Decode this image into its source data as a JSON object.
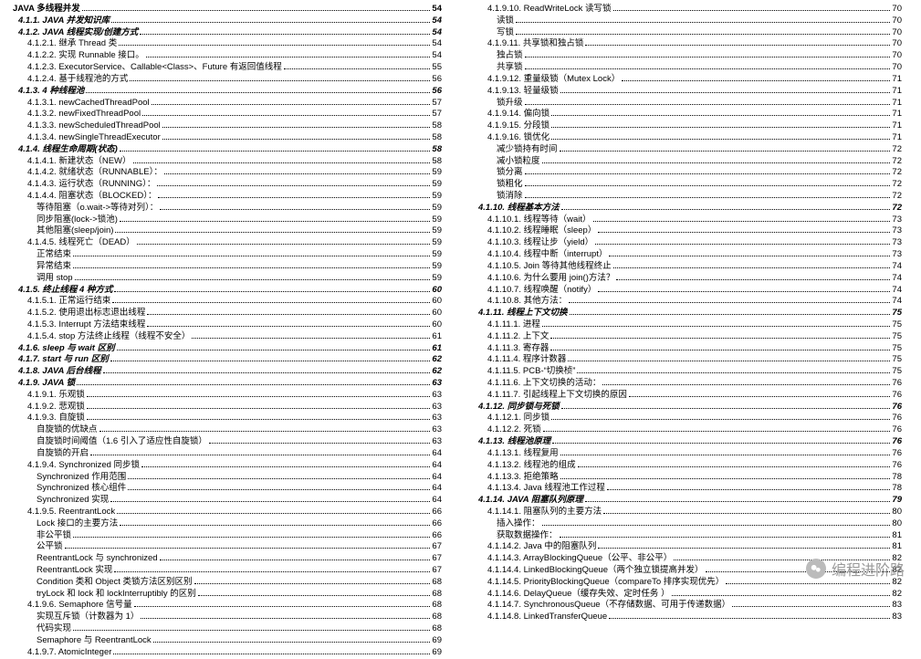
{
  "watermark": {
    "text": "编程进阶路"
  },
  "columns": [
    [
      {
        "lvl": 0,
        "t": "JAVA 多线程并发",
        "p": "54"
      },
      {
        "lvl": 1,
        "t": "4.1.1.  JAVA 并发知识库",
        "p": "54"
      },
      {
        "lvl": 1,
        "t": "4.1.2.  JAVA 线程实现/创建方式",
        "p": "54"
      },
      {
        "lvl": 2,
        "t": "4.1.2.1.  继承 Thread 类",
        "p": "54"
      },
      {
        "lvl": 2,
        "t": "4.1.2.2.  实现 Runnable 接口。",
        "p": "54"
      },
      {
        "lvl": 2,
        "t": "4.1.2.3.  ExecutorService、Callable<Class>、Future 有返回值线程",
        "p": "55"
      },
      {
        "lvl": 2,
        "t": "4.1.2.4.  基于线程池的方式",
        "p": "56"
      },
      {
        "lvl": 1,
        "t": "4.1.3.  4 种线程池",
        "p": "56"
      },
      {
        "lvl": 2,
        "t": "4.1.3.1.  newCachedThreadPool",
        "p": "57"
      },
      {
        "lvl": 2,
        "t": "4.1.3.2.  newFixedThreadPool",
        "p": "57"
      },
      {
        "lvl": 2,
        "t": "4.1.3.3.  newScheduledThreadPool",
        "p": "58"
      },
      {
        "lvl": 2,
        "t": "4.1.3.4.  newSingleThreadExecutor",
        "p": "58"
      },
      {
        "lvl": 1,
        "t": "4.1.4.  线程生命周期(状态)",
        "p": "58"
      },
      {
        "lvl": 2,
        "t": "4.1.4.1.  新建状态（NEW）",
        "p": "58"
      },
      {
        "lvl": 2,
        "t": "4.1.4.2.  就绪状态（RUNNABLE）：",
        "p": "59"
      },
      {
        "lvl": 2,
        "t": "4.1.4.3.  运行状态（RUNNING）：",
        "p": "59"
      },
      {
        "lvl": 2,
        "t": "4.1.4.4.  阻塞状态（BLOCKED）：",
        "p": "59"
      },
      {
        "lvl": 3,
        "t": "等待阻塞（o.wait->等待对列）：",
        "p": "59"
      },
      {
        "lvl": 3,
        "t": "同步阻塞(lock->锁池)",
        "p": "59"
      },
      {
        "lvl": 3,
        "t": "其他阻塞(sleep/join)",
        "p": "59"
      },
      {
        "lvl": 2,
        "t": "4.1.4.5.  线程死亡（DEAD）",
        "p": "59"
      },
      {
        "lvl": 3,
        "t": "正常结束",
        "p": "59"
      },
      {
        "lvl": 3,
        "t": "异常结束",
        "p": "59"
      },
      {
        "lvl": 3,
        "t": "调用 stop",
        "p": "59"
      },
      {
        "lvl": 1,
        "t": "4.1.5.  终止线程 4 种方式",
        "p": "60"
      },
      {
        "lvl": 2,
        "t": "4.1.5.1.  正常运行结束",
        "p": "60"
      },
      {
        "lvl": 2,
        "t": "4.1.5.2.  使用退出标志退出线程",
        "p": "60"
      },
      {
        "lvl": 2,
        "t": "4.1.5.3.  Interrupt 方法结束线程",
        "p": "60"
      },
      {
        "lvl": 2,
        "t": "4.1.5.4.  stop 方法终止线程（线程不安全）",
        "p": "61"
      },
      {
        "lvl": 1,
        "t": "4.1.6.  sleep 与 wait 区别",
        "p": "61"
      },
      {
        "lvl": 1,
        "t": "4.1.7.  start 与 run 区别",
        "p": "62"
      },
      {
        "lvl": 1,
        "t": "4.1.8.  JAVA 后台线程",
        "p": "62"
      },
      {
        "lvl": 1,
        "t": "4.1.9.  JAVA 锁",
        "p": "63"
      },
      {
        "lvl": 2,
        "t": "4.1.9.1.  乐观锁",
        "p": "63"
      },
      {
        "lvl": 2,
        "t": "4.1.9.2.  悲观锁",
        "p": "63"
      },
      {
        "lvl": 2,
        "t": "4.1.9.3.  自旋锁",
        "p": "63"
      },
      {
        "lvl": 3,
        "t": "自旋锁的优缺点",
        "p": "63"
      },
      {
        "lvl": 3,
        "t": "自旋锁时间阈值（1.6 引入了适应性自旋锁）",
        "p": "63"
      },
      {
        "lvl": 3,
        "t": "自旋锁的开启",
        "p": "64"
      },
      {
        "lvl": 2,
        "t": "4.1.9.4.  Synchronized 同步锁",
        "p": "64"
      },
      {
        "lvl": 3,
        "t": "Synchronized 作用范围",
        "p": "64"
      },
      {
        "lvl": 3,
        "t": "Synchronized 核心组件",
        "p": "64"
      },
      {
        "lvl": 3,
        "t": "Synchronized 实现",
        "p": "64"
      },
      {
        "lvl": 2,
        "t": "4.1.9.5.  ReentrantLock",
        "p": "66"
      },
      {
        "lvl": 3,
        "t": "Lock 接口的主要方法",
        "p": "66"
      },
      {
        "lvl": 3,
        "t": "非公平锁",
        "p": "66"
      },
      {
        "lvl": 3,
        "t": "公平锁",
        "p": "67"
      },
      {
        "lvl": 3,
        "t": "ReentrantLock 与 synchronized",
        "p": "67"
      },
      {
        "lvl": 3,
        "t": "ReentrantLock 实现",
        "p": "67"
      },
      {
        "lvl": 3,
        "t": "Condition 类和 Object 类锁方法区别区别",
        "p": "68"
      },
      {
        "lvl": 3,
        "t": "tryLock 和 lock 和 lockInterruptibly 的区别",
        "p": "68"
      },
      {
        "lvl": 2,
        "t": "4.1.9.6.  Semaphore 信号量",
        "p": "68"
      },
      {
        "lvl": 3,
        "t": "实现互斥锁（计数器为 1）",
        "p": "68"
      },
      {
        "lvl": 3,
        "t": "代码实现",
        "p": "68"
      },
      {
        "lvl": 3,
        "t": "Semaphore 与 ReentrantLock",
        "p": "69"
      },
      {
        "lvl": 2,
        "t": "4.1.9.7.  AtomicInteger",
        "p": "69"
      }
    ],
    [
      {
        "lvl": 2,
        "t": "4.1.9.10.  ReadWriteLock 读写锁",
        "p": "70"
      },
      {
        "lvl": 3,
        "t": "读锁",
        "p": "70"
      },
      {
        "lvl": 3,
        "t": "写锁",
        "p": "70"
      },
      {
        "lvl": 2,
        "t": "4.1.9.11.  共享锁和独占锁",
        "p": "70"
      },
      {
        "lvl": 3,
        "t": "独占锁",
        "p": "70"
      },
      {
        "lvl": 3,
        "t": "共享锁",
        "p": "70"
      },
      {
        "lvl": 2,
        "t": "4.1.9.12.  重量级锁（Mutex Lock）",
        "p": "71"
      },
      {
        "lvl": 2,
        "t": "4.1.9.13.  轻量级锁",
        "p": "71"
      },
      {
        "lvl": 3,
        "t": "锁升级",
        "p": "71"
      },
      {
        "lvl": 2,
        "t": "4.1.9.14.  偏向锁",
        "p": "71"
      },
      {
        "lvl": 2,
        "t": "4.1.9.15.  分段锁",
        "p": "71"
      },
      {
        "lvl": 2,
        "t": "4.1.9.16.  锁优化",
        "p": "71"
      },
      {
        "lvl": 3,
        "t": "减少锁持有时间",
        "p": "72"
      },
      {
        "lvl": 3,
        "t": "减小锁粒度",
        "p": "72"
      },
      {
        "lvl": 3,
        "t": "锁分离",
        "p": "72"
      },
      {
        "lvl": 3,
        "t": "锁粗化",
        "p": "72"
      },
      {
        "lvl": 3,
        "t": "锁消除",
        "p": "72"
      },
      {
        "lvl": 1,
        "t": "4.1.10.  线程基本方法",
        "p": "72"
      },
      {
        "lvl": 2,
        "t": "4.1.10.1.  线程等待（wait）",
        "p": "73"
      },
      {
        "lvl": 2,
        "t": "4.1.10.2.  线程睡眠（sleep）",
        "p": "73"
      },
      {
        "lvl": 2,
        "t": "4.1.10.3.  线程让步（yield）",
        "p": "73"
      },
      {
        "lvl": 2,
        "t": "4.1.10.4.  线程中断（interrupt）",
        "p": "73"
      },
      {
        "lvl": 2,
        "t": "4.1.10.5.  Join 等待其他线程终止",
        "p": "74"
      },
      {
        "lvl": 2,
        "t": "4.1.10.6.  为什么要用 join()方法？",
        "p": "74"
      },
      {
        "lvl": 2,
        "t": "4.1.10.7.  线程唤醒（notify）",
        "p": "74"
      },
      {
        "lvl": 2,
        "t": "4.1.10.8.  其他方法：",
        "p": "74"
      },
      {
        "lvl": 1,
        "t": "4.1.11.  线程上下文切换",
        "p": "75"
      },
      {
        "lvl": 2,
        "t": "4.1.11.1.  进程",
        "p": "75"
      },
      {
        "lvl": 2,
        "t": "4.1.11.2.  上下文",
        "p": "75"
      },
      {
        "lvl": 2,
        "t": "4.1.11.3.  寄存器",
        "p": "75"
      },
      {
        "lvl": 2,
        "t": "4.1.11.4.  程序计数器",
        "p": "75"
      },
      {
        "lvl": 2,
        "t": "4.1.11.5.  PCB-“切换桢”",
        "p": "75"
      },
      {
        "lvl": 2,
        "t": "4.1.11.6.  上下文切换的活动：",
        "p": "76"
      },
      {
        "lvl": 2,
        "t": "4.1.11.7.  引起线程上下文切换的原因",
        "p": "76"
      },
      {
        "lvl": 1,
        "t": "4.1.12.  同步锁与死锁",
        "p": "76"
      },
      {
        "lvl": 2,
        "t": "4.1.12.1.  同步锁",
        "p": "76"
      },
      {
        "lvl": 2,
        "t": "4.1.12.2.  死锁",
        "p": "76"
      },
      {
        "lvl": 1,
        "t": "4.1.13.  线程池原理",
        "p": "76"
      },
      {
        "lvl": 2,
        "t": "4.1.13.1.  线程复用",
        "p": "76"
      },
      {
        "lvl": 2,
        "t": "4.1.13.2.  线程池的组成",
        "p": "76"
      },
      {
        "lvl": 2,
        "t": "4.1.13.3.  拒绝策略",
        "p": "78"
      },
      {
        "lvl": 2,
        "t": "4.1.13.4.  Java 线程池工作过程",
        "p": "78"
      },
      {
        "lvl": 1,
        "t": "4.1.14.  JAVA 阻塞队列原理",
        "p": "79"
      },
      {
        "lvl": 2,
        "t": "4.1.14.1.  阻塞队列的主要方法",
        "p": "80"
      },
      {
        "lvl": 3,
        "t": "插入操作：",
        "p": "80"
      },
      {
        "lvl": 3,
        "t": "获取数据操作：",
        "p": "81"
      },
      {
        "lvl": 2,
        "t": "4.1.14.2.  Java 中的阻塞队列",
        "p": "81"
      },
      {
        "lvl": 2,
        "t": "4.1.14.3.  ArrayBlockingQueue（公平、非公平）",
        "p": "82"
      },
      {
        "lvl": 2,
        "t": "4.1.14.4.  LinkedBlockingQueue（两个独立锁提高并发）",
        "p": "82"
      },
      {
        "lvl": 2,
        "t": "4.1.14.5.  PriorityBlockingQueue（compareTo 排序实现优先）",
        "p": "82"
      },
      {
        "lvl": 2,
        "t": "4.1.14.6.  DelayQueue（缓存失效、定时任务 ）",
        "p": "82"
      },
      {
        "lvl": 2,
        "t": "4.1.14.7.  SynchronousQueue（不存储数据、可用于传递数据）",
        "p": "83"
      },
      {
        "lvl": 2,
        "t": "4.1.14.8.  LinkedTransferQueue",
        "p": "83"
      }
    ]
  ]
}
